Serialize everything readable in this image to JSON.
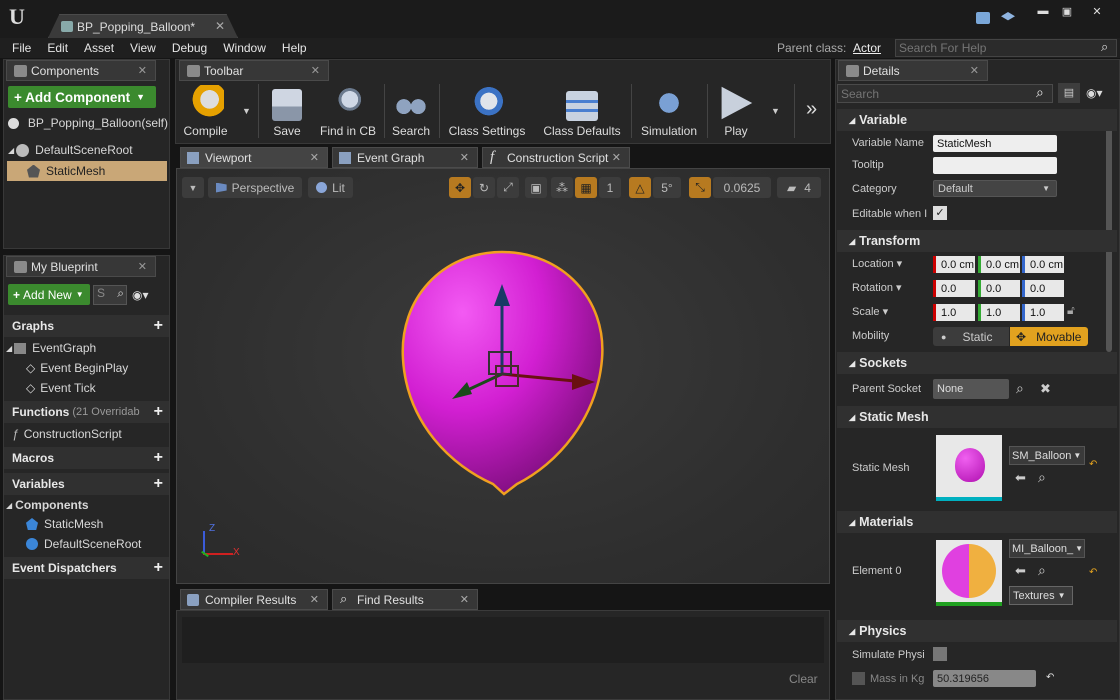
{
  "app": {
    "logo": "U",
    "doc_tab": "BP_Popping_Balloon*"
  },
  "menu": [
    "File",
    "Edit",
    "Asset",
    "View",
    "Debug",
    "Window",
    "Help"
  ],
  "parent_class": {
    "label": "Parent class:",
    "value": "Actor"
  },
  "help_search": {
    "placeholder": "Search For Help"
  },
  "components_panel": {
    "tab": "Components",
    "add_label": "+ Add Component",
    "root_label": "BP_Popping_Balloon(self)",
    "tree": [
      "DefaultSceneRoot",
      "StaticMesh"
    ]
  },
  "toolbar": {
    "tab": "Toolbar",
    "buttons": [
      "Compile",
      "Save",
      "Find in CB",
      "Search",
      "Class Settings",
      "Class Defaults",
      "Simulation",
      "Play"
    ]
  },
  "editor_tabs": [
    "Viewport",
    "Event Graph",
    "Construction Script"
  ],
  "viewport": {
    "perspective": "Perspective",
    "lit": "Lit",
    "snap_grid": "1",
    "snap_angle": "5°",
    "snap_scale": "0.0625",
    "cam_speed": "4",
    "axis_z": "Z",
    "axis_x": "X"
  },
  "my_blueprint": {
    "tab": "My Blueprint",
    "add_new": "Add New",
    "search_placeholder": "S",
    "graphs_header": "Graphs",
    "event_graph": "EventGraph",
    "events": [
      "Event BeginPlay",
      "Event Tick"
    ],
    "functions_header": "Functions",
    "functions_note": "(21 Overridab",
    "construction_script": "ConstructionScript",
    "macros_header": "Macros",
    "variables_header": "Variables",
    "components_header": "Components",
    "component_vars": [
      "StaticMesh",
      "DefaultSceneRoot"
    ],
    "dispatchers_header": "Event Dispatchers"
  },
  "bottom": {
    "tabs": [
      "Compiler Results",
      "Find Results"
    ],
    "clear": "Clear"
  },
  "details": {
    "tab": "Details",
    "search_placeholder": "Search",
    "variable": {
      "header": "Variable",
      "name_label": "Variable Name",
      "name_value": "StaticMesh",
      "tooltip_label": "Tooltip",
      "tooltip_value": "",
      "category_label": "Category",
      "category_value": "Default",
      "editable_label": "Editable when I"
    },
    "transform": {
      "header": "Transform",
      "location_label": "Location",
      "location": [
        "0.0 cm",
        "0.0 cm",
        "0.0 cm"
      ],
      "rotation_label": "Rotation",
      "rotation": [
        "0.0",
        "0.0",
        "0.0"
      ],
      "scale_label": "Scale",
      "scale": [
        "1.0",
        "1.0",
        "1.0"
      ],
      "mobility_label": "Mobility",
      "static": "Static",
      "movable": "Movable"
    },
    "sockets": {
      "header": "Sockets",
      "parent_label": "Parent Socket",
      "parent_value": "None"
    },
    "static_mesh": {
      "header": "Static Mesh",
      "label": "Static Mesh",
      "asset": "SM_Balloon"
    },
    "materials": {
      "header": "Materials",
      "label": "Element 0",
      "asset": "MI_Balloon_",
      "textures": "Textures"
    },
    "physics": {
      "header": "Physics",
      "simulate_label": "Simulate Physi",
      "mass_label": "Mass in Kg",
      "mass_value": "50.319656"
    }
  }
}
